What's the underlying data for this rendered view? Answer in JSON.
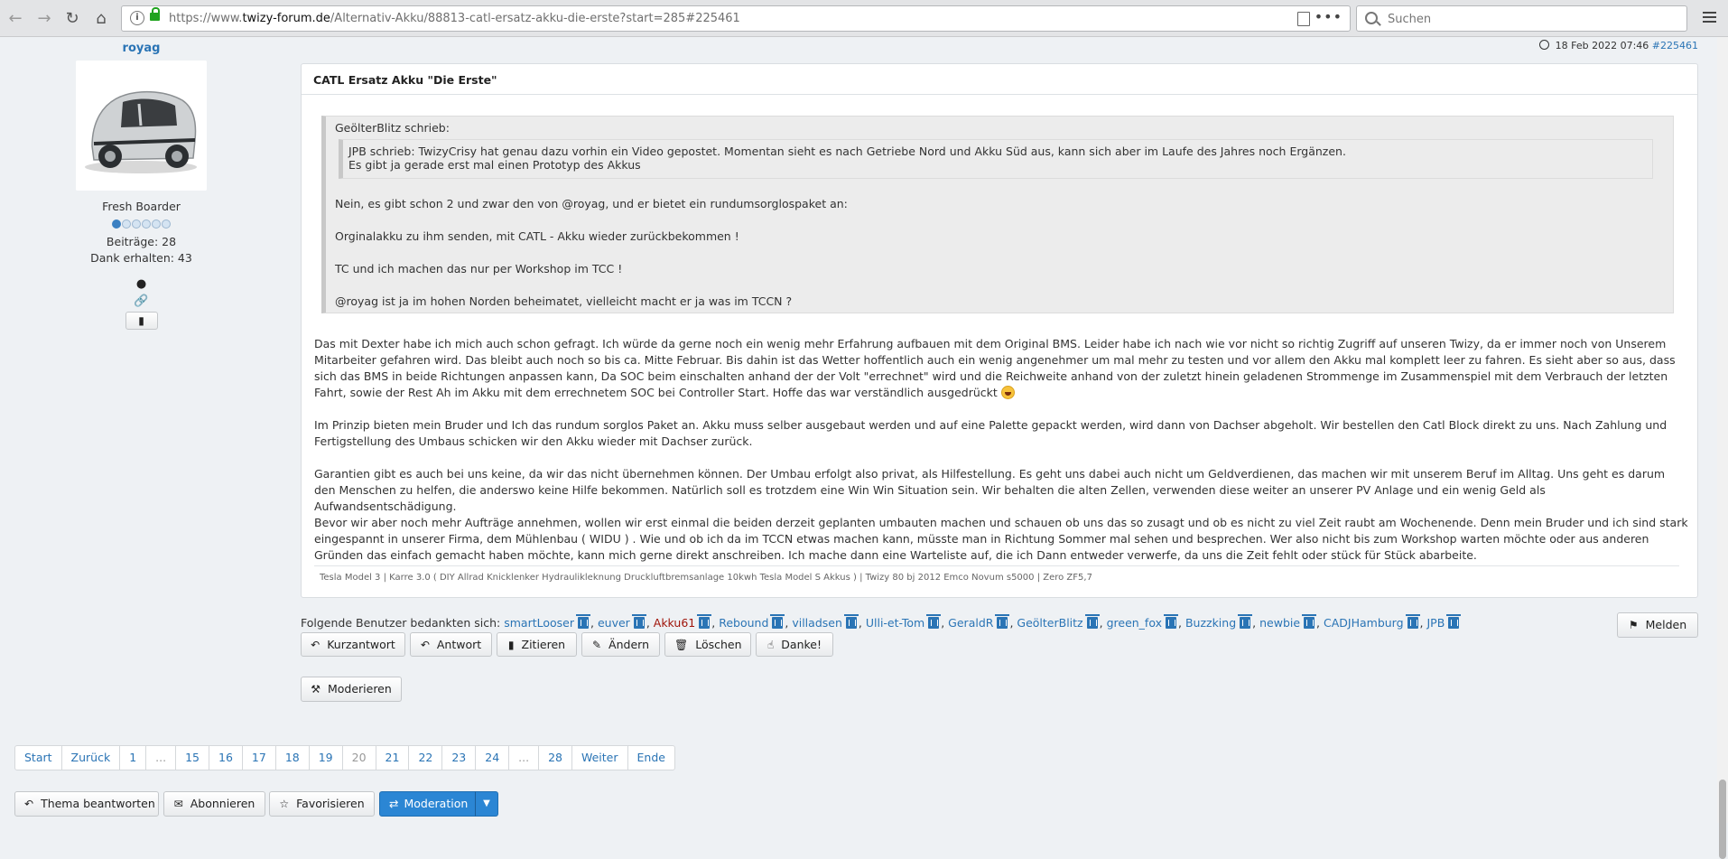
{
  "browser": {
    "url_prefix": "https://www.",
    "url_host": "twizy-forum.de",
    "url_path": "/Alternativ-Akku/88813-catl-ersatz-akku-die-erste?start=285#225461",
    "search_placeholder": "Suchen"
  },
  "profile": {
    "username": "royag",
    "rank": "Fresh Boarder",
    "rank_level": 1,
    "rank_max": 6,
    "posts": "Beiträge: 28",
    "thanks_received": "Dank erhalten: 43"
  },
  "post": {
    "date": "18 Feb 2022 07:46",
    "id_link": "#225461",
    "title": "CATL Ersatz Akku \"Die Erste\"",
    "quote_author": "GeölterBlitz schrieb:",
    "inner_quote_line1": "JPB schrieb: TwizyCrisy hat genau dazu vorhin ein Video gepostet. Momentan sieht es nach Getriebe Nord und Akku Süd aus, kann sich aber im Laufe des Jahres noch Ergänzen.",
    "inner_quote_line2": "Es gibt ja gerade erst mal einen Prototyp des Akkus",
    "quote_p1": "Nein, es gibt schon 2 und zwar den von @royag, und er bietet ein rundumsorglospaket an:",
    "quote_p2": "Orginalakku zu ihm senden, mit CATL - Akku wieder zurückbekommen !",
    "quote_p3": "TC und ich machen das nur per Workshop im TCC !",
    "quote_p4": "@royag ist ja im hohen Norden beheimatet, vielleicht macht er ja was im TCCN ?",
    "body_p1": "Das mit Dexter habe ich mich auch schon gefragt. Ich würde da gerne noch ein wenig mehr Erfahrung aufbauen mit dem Original BMS. Leider habe ich nach wie vor nicht so richtig Zugriff auf unseren Twizy, da er immer noch von Unserem Mitarbeiter gefahren wird. Das bleibt auch noch so bis ca. Mitte Februar. Bis dahin ist das Wetter hoffentlich auch ein wenig angenehmer um mal mehr zu testen und vor allem den Akku mal komplett leer zu fahren. Es sieht aber so aus, dass sich das BMS in beide Richtungen anpassen kann, Da SOC beim einschalten anhand der der Volt \"errechnet\" wird und die Reichweite anhand von der zuletzt hinein geladenen Strommenge im Zusammenspiel mit dem Verbrauch der letzten Fahrt, sowie der Rest Ah im Akku mit dem errechnetem SOC bei Controller Start. Hoffe das war verständlich ausgedrückt",
    "body_p2": "Im Prinzip bieten mein Bruder und Ich das rundum sorglos Paket an. Akku muss selber ausgebaut werden und auf eine Palette gepackt werden, wird dann von Dachser abgeholt. Wir bestellen den Catl Block direkt zu uns. Nach Zahlung und Fertigstellung des Umbaus schicken wir den Akku wieder mit Dachser zurück.",
    "body_p3": "Garantien gibt es auch bei uns keine, da wir das nicht übernehmen können. Der Umbau erfolgt also privat, als Hilfestellung. Es geht uns dabei auch nicht um Geldverdienen, das machen wir mit unserem Beruf im Alltag. Uns geht es darum den Menschen zu helfen, die anderswo keine Hilfe bekommen. Natürlich soll es trotzdem eine Win Win Situation sein. Wir behalten die alten Zellen, verwenden diese weiter an unserer PV Anlage und ein wenig Geld als Aufwandsentschädigung.",
    "body_p4": "Bevor wir aber noch mehr Aufträge annehmen, wollen wir erst einmal die beiden derzeit geplanten umbauten machen und schauen ob uns das so zusagt und ob es nicht zu viel Zeit raubt am Wochenende. Denn mein Bruder und ich sind stark eingespannt in unserer Firma, dem Mühlenbau ( WIDU ) . Wie und ob ich da im TCCN etwas machen kann, müsste man in Richtung Sommer mal sehen und besprechen. Wer also nicht bis zum Workshop warten möchte oder aus anderen Gründen das einfach gemacht haben möchte, kann mich gerne direkt anschreiben. Ich mache dann eine Warteliste auf, die ich Dann entweder verwerfe, da uns die Zeit fehlt oder stück für Stück abarbeite.",
    "signature": "Tesla Model 3 | Karre 3.0 ( DIY Allrad Knicklenker Hydraulikleknung Druckluftbremsanlage 10kwh Tesla Model S Akkus ) | Twizy 80 bj 2012 Emco Novum s5000 | Zero ZF5,7"
  },
  "thanks": {
    "label": "Folgende Benutzer bedankten sich:",
    "users": [
      "smartLooser",
      "euver",
      "Akku61",
      "Rebound",
      "villadsen",
      "Ulli-et-Tom",
      "GeraldR",
      "GeölterBlitz",
      "green_fox",
      "Buzzking",
      "newbie",
      "CADJHamburg",
      "JPB"
    ],
    "highlight_user": "Akku61"
  },
  "actions": {
    "report": "Melden",
    "quick_reply": "Kurzantwort",
    "reply": "Antwort",
    "quote": "Zitieren",
    "edit": "Ändern",
    "delete": "Löschen",
    "thank": "Danke!",
    "moderate": "Moderieren"
  },
  "pagination": [
    "Start",
    "Zurück",
    "1",
    "...",
    "15",
    "16",
    "17",
    "18",
    "19",
    "20",
    "21",
    "22",
    "23",
    "24",
    "...",
    "28",
    "Weiter",
    "Ende"
  ],
  "current_page": "20",
  "bottom": {
    "reply_topic": "Thema beantworten",
    "subscribe": "Abonnieren",
    "favorite": "Favorisieren",
    "moderation": "Moderation"
  },
  "colors": {
    "link": "#2a74b5",
    "primary": "#2b86d4",
    "highlight_user": "#a0150b"
  }
}
